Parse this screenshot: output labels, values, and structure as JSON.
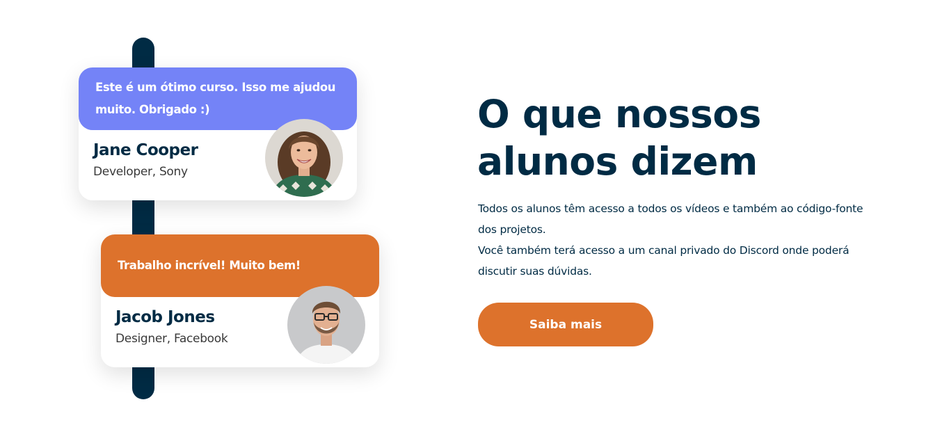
{
  "testimonials": [
    {
      "quote": "Este é um ótimo curso. Isso me ajudou muito. Obrigado :)",
      "name": "Jane Cooper",
      "role": "Developer, Sony",
      "accent": "#7483f7"
    },
    {
      "quote": "Trabalho incrível! Muito bem!",
      "name": "Jacob Jones",
      "role": "Designer, Facebook",
      "accent": "#dd722c"
    }
  ],
  "section": {
    "title": "O que nossos alunos dizem",
    "description_lines": [
      "Todos os alunos têm acesso a todos os vídeos e também ao código-fonte dos projetos.",
      "Você também terá acesso a um canal privado do Discord onde poderá discutir suas dúvidas."
    ],
    "button_label": "Saiba mais"
  },
  "colors": {
    "navy": "#002b44",
    "purple": "#7483f7",
    "orange": "#dd722c",
    "white": "#ffffff"
  }
}
